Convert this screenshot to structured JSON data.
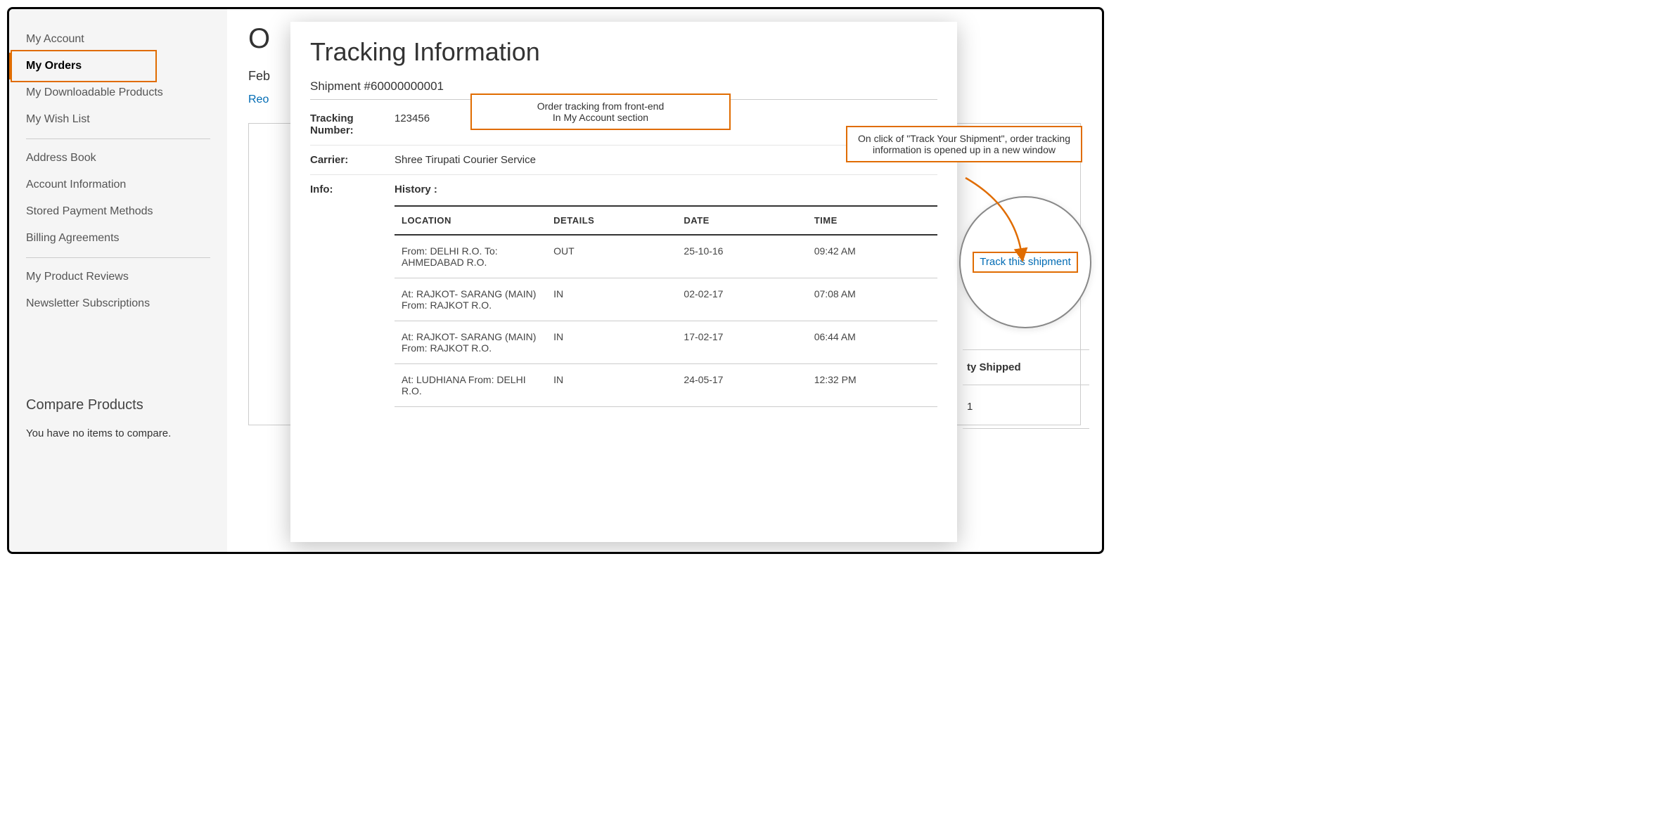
{
  "sidebar": {
    "items": [
      {
        "label": "My Account"
      },
      {
        "label": "My Orders"
      },
      {
        "label": "My Downloadable Products"
      },
      {
        "label": "My Wish List"
      }
    ],
    "items2": [
      {
        "label": "Address Book"
      },
      {
        "label": "Account Information"
      },
      {
        "label": "Stored Payment Methods"
      },
      {
        "label": "Billing Agreements"
      }
    ],
    "items3": [
      {
        "label": "My Product Reviews"
      },
      {
        "label": "Newsletter Subscriptions"
      }
    ]
  },
  "compare": {
    "title": "Compare Products",
    "text": "You have no items to compare."
  },
  "main_stub": {
    "order_letter": "O",
    "date_prefix": "Feb",
    "reorder": "Reo"
  },
  "modal": {
    "title": "Tracking Information",
    "shipment": "Shipment #60000000001",
    "tracking_label": "Tracking Number:",
    "tracking_value": "123456",
    "carrier_label": "Carrier:",
    "carrier_value": "Shree Tirupati Courier Service",
    "info_label": "Info:",
    "history_label": "History :",
    "columns": {
      "location": "LOCATION",
      "details": "DETAILS",
      "date": "DATE",
      "time": "TIME"
    },
    "rows": [
      {
        "location": "From: DELHI R.O. To: AHMEDABAD R.O.",
        "details": "OUT",
        "date": "25-10-16",
        "time": "09:42 AM"
      },
      {
        "location": "At: RAJKOT- SARANG (MAIN) From: RAJKOT R.O.",
        "details": "IN",
        "date": "02-02-17",
        "time": "07:08 AM"
      },
      {
        "location": "At: RAJKOT- SARANG (MAIN) From: RAJKOT R.O.",
        "details": "IN",
        "date": "17-02-17",
        "time": "06:44 AM"
      },
      {
        "location": "At: LUDHIANA From: DELHI R.O.",
        "details": "IN",
        "date": "24-05-17",
        "time": "12:32 PM"
      }
    ]
  },
  "callouts": {
    "c1_line1": "Order tracking from front-end",
    "c1_line2": "In My Account section",
    "c2": "On click of \"Track Your Shipment\", order tracking information is opened up in a new window"
  },
  "zoom": {
    "link_text": "Track this shipment"
  },
  "behind": {
    "header": "ty Shipped",
    "value": "1"
  }
}
